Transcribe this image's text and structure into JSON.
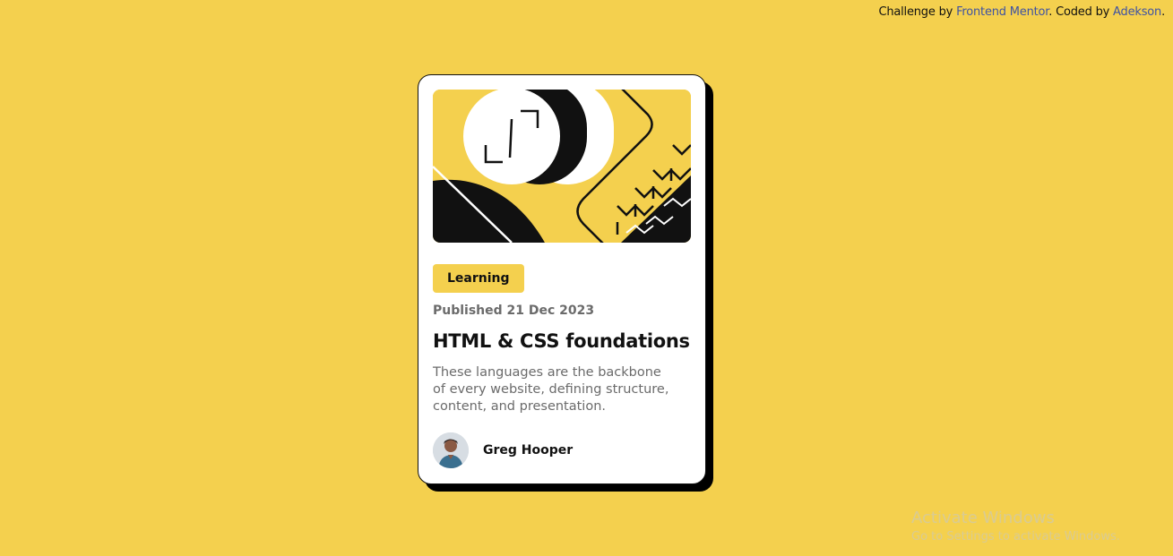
{
  "attribution": {
    "prefix": "Challenge by ",
    "link1": "Frontend Mentor",
    "middle": ". Coded by ",
    "link2": "Adekson",
    "suffix": "."
  },
  "card": {
    "category": "Learning",
    "published": "Published 21 Dec 2023",
    "title": "HTML & CSS foundations",
    "description": "These languages are the backbone of every website, defining structure, content, and presentation.",
    "author": "Greg Hooper",
    "hero_icon": "code-brackets-illustration",
    "avatar_icon": "author-avatar"
  },
  "watermark": {
    "title": "Activate Windows",
    "subtitle": "Go to Settings to activate Windows."
  },
  "colors": {
    "background": "#F4D04E",
    "card": "#FFFFFF",
    "text_dark": "#111111",
    "text_muted": "#6B6B6B",
    "link": "#3E52A3"
  }
}
